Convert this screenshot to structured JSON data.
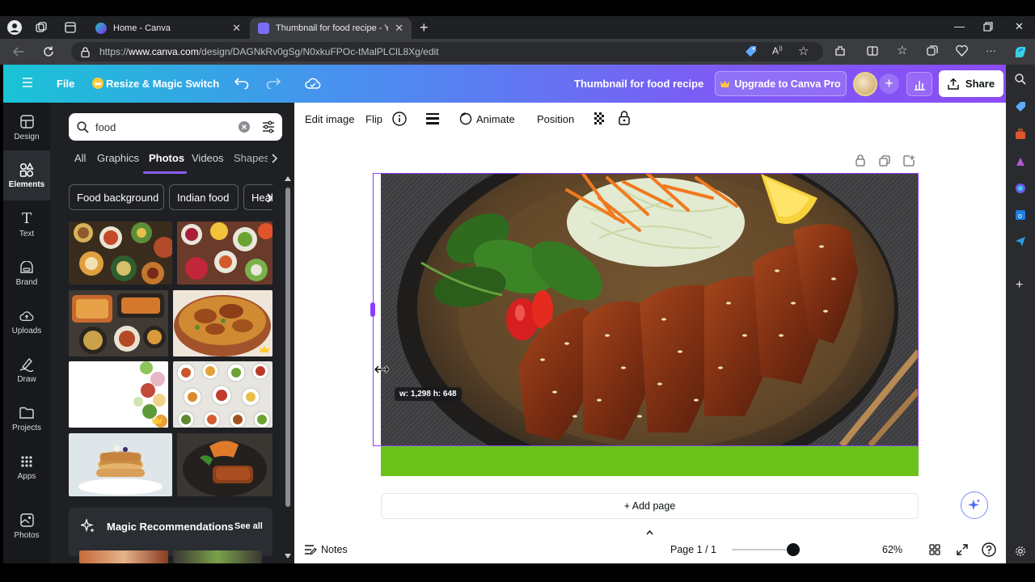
{
  "browser": {
    "tabs": [
      {
        "title": "Home - Canva",
        "active": false
      },
      {
        "title": "Thumbnail for food recipe - YouTube",
        "active": true
      }
    ],
    "url_prefix": "https://",
    "url_host": "www.canva.com",
    "url_path": "/design/DAGNkRv0gSg/N0xkuFPOc-tMalPLClL8Xg/edit"
  },
  "header": {
    "file_label": "File",
    "resize_label": "Resize & Magic Switch",
    "design_title": "Thumbnail for food recipe",
    "upgrade_label": "Upgrade to Canva Pro",
    "share_label": "Share"
  },
  "leftnav": {
    "items": [
      {
        "label": "Design",
        "icon": "design-icon"
      },
      {
        "label": "Elements",
        "icon": "elements-icon",
        "active": true
      },
      {
        "label": "Text",
        "icon": "text-icon"
      },
      {
        "label": "Brand",
        "icon": "brand-icon"
      },
      {
        "label": "Uploads",
        "icon": "uploads-icon"
      },
      {
        "label": "Draw",
        "icon": "draw-icon"
      },
      {
        "label": "Projects",
        "icon": "projects-icon"
      },
      {
        "label": "Apps",
        "icon": "apps-icon"
      },
      {
        "label": "Photos",
        "icon": "photos-icon"
      }
    ]
  },
  "panel": {
    "search_value": "food",
    "filters": [
      "All",
      "Graphics",
      "Photos",
      "Videos",
      "Shapes"
    ],
    "active_filter": "Photos",
    "chips": [
      "Food background",
      "Indian food",
      "Healthy food"
    ],
    "magic_title": "Magic Recommendations",
    "see_all": "See all"
  },
  "toolbar": {
    "edit_image": "Edit image",
    "flip": "Flip",
    "animate": "Animate",
    "position": "Position"
  },
  "canvas": {
    "dimension_badge": "w: 1,298 h: 648",
    "add_page": "+ Add page",
    "accent_color": "#6ac21a",
    "selection_color": "#8b3dff"
  },
  "footer": {
    "notes": "Notes",
    "page_indicator": "Page 1 / 1",
    "zoom": "62%"
  }
}
